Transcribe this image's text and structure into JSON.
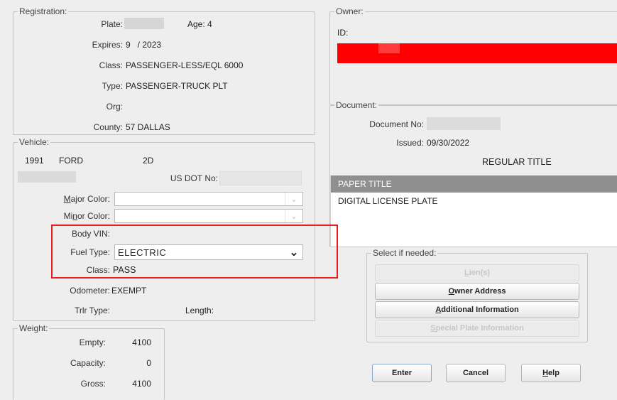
{
  "registration": {
    "legend": "Registration:",
    "plate_label": "Plate:",
    "age_label": "Age: 4",
    "expires_label": "Expires:",
    "expires_value": "9   / 2023",
    "class_label": "Class:",
    "class_value": "PASSENGER-LESS/EQL 6000",
    "type_label": "Type:",
    "type_value": "PASSENGER-TRUCK PLT",
    "org_label": "Org:",
    "county_label": "County:",
    "county_value": "57 DALLAS"
  },
  "owner": {
    "legend": "Owner:",
    "id_label": "ID:"
  },
  "document": {
    "legend": "Document:",
    "doc_no_label": "Document No:",
    "issued_label": "Issued:",
    "issued_value": "09/30/2022",
    "title_type": "REGULAR TITLE",
    "list_items": [
      "PAPER TITLE",
      "DIGITAL LICENSE PLATE"
    ],
    "selected_index": 0
  },
  "vehicle": {
    "legend": "Vehicle:",
    "year": "1991",
    "make": "FORD",
    "body": "2D",
    "usdot_label": "US DOT No:",
    "major_color_label_pre": "",
    "major_color_label_u": "M",
    "major_color_label_post": "ajor Color:",
    "minor_color_label_pre": "Mi",
    "minor_color_label_u": "n",
    "minor_color_label_post": "or Color:",
    "body_vin_label": "Body VIN:",
    "fuel_type_label": "Fuel Type:",
    "fuel_type_value": "ELECTRIC",
    "class_label": "Class:",
    "class_value": "PASS",
    "odometer_label": "Odometer:",
    "odometer_value": "EXEMPT",
    "trlr_type_label": "Trlr Type:",
    "length_label": "Length:"
  },
  "weight": {
    "legend": "Weight:",
    "empty_label": "Empty:",
    "empty_value": "4100",
    "capacity_label": "Capacity:",
    "capacity_value": "0",
    "gross_label": "Gross:",
    "gross_value": "4100"
  },
  "select_if_needed": {
    "legend": "Select if needed:",
    "liens_pre": "",
    "liens_u": "L",
    "liens_post": "ien(s)",
    "owner_addr_pre": "",
    "owner_addr_u": "O",
    "owner_addr_post": "wner Address",
    "addl_info_pre": "",
    "addl_info_u": "A",
    "addl_info_post": "dditional Information",
    "special_plate_pre": "",
    "special_plate_u": "S",
    "special_plate_post": "pecial Plate Information"
  },
  "actions": {
    "enter": "Enter",
    "cancel": "Cancel",
    "help_pre": "",
    "help_u": "H",
    "help_post": "elp"
  },
  "colors": {
    "highlight": "#e41e1e",
    "redaction": "#ff0000",
    "selected_row": "#8f8f8f"
  }
}
